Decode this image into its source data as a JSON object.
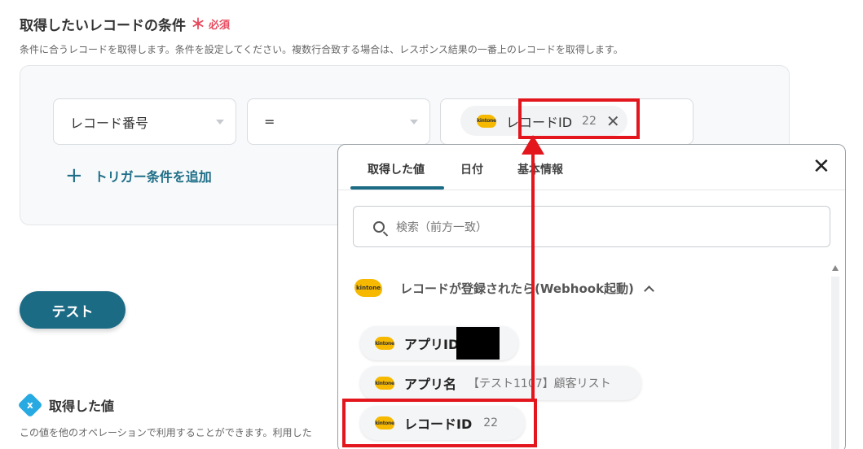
{
  "section": {
    "title": "取得したいレコードの条件",
    "required_mark": "＊",
    "required_label": "必須",
    "description": "条件に合うレコードを取得します。条件を設定してください。複数行合致する場合は、レスポンス結果の一番上のレコードを取得します。"
  },
  "condition": {
    "field_select": "レコード番号",
    "operator_select": "=",
    "value_chip": {
      "icon": "kintone",
      "label": "レコードID",
      "value": "22",
      "remove": "✕"
    },
    "add_trigger_plus": "+",
    "add_trigger_label": "トリガー条件を追加"
  },
  "test_button": "テスト",
  "acquired": {
    "badge": "x",
    "title": "取得した値",
    "description": "この値を他のオペレーションで利用することができます。利用した"
  },
  "dropdown": {
    "tabs": [
      {
        "label": "取得した値"
      },
      {
        "label": "日付"
      },
      {
        "label": "基本情報"
      }
    ],
    "close": "✕",
    "search_placeholder": "検索（前方一致）",
    "group": {
      "icon": "kintone",
      "label": "レコードが登録されたら(Webhook起動)"
    },
    "items": [
      {
        "icon": "kintone",
        "label": "アプリID",
        "value": ""
      },
      {
        "icon": "kintone",
        "label": "アプリ名",
        "value": "【テスト1107】顧客リスト"
      },
      {
        "icon": "kintone",
        "label": "レコードID",
        "value": "22"
      }
    ]
  },
  "colors": {
    "accent": "#1c6b85",
    "required": "#e84a5f",
    "highlight": "#e3161d",
    "kintone": "#f6b900"
  }
}
